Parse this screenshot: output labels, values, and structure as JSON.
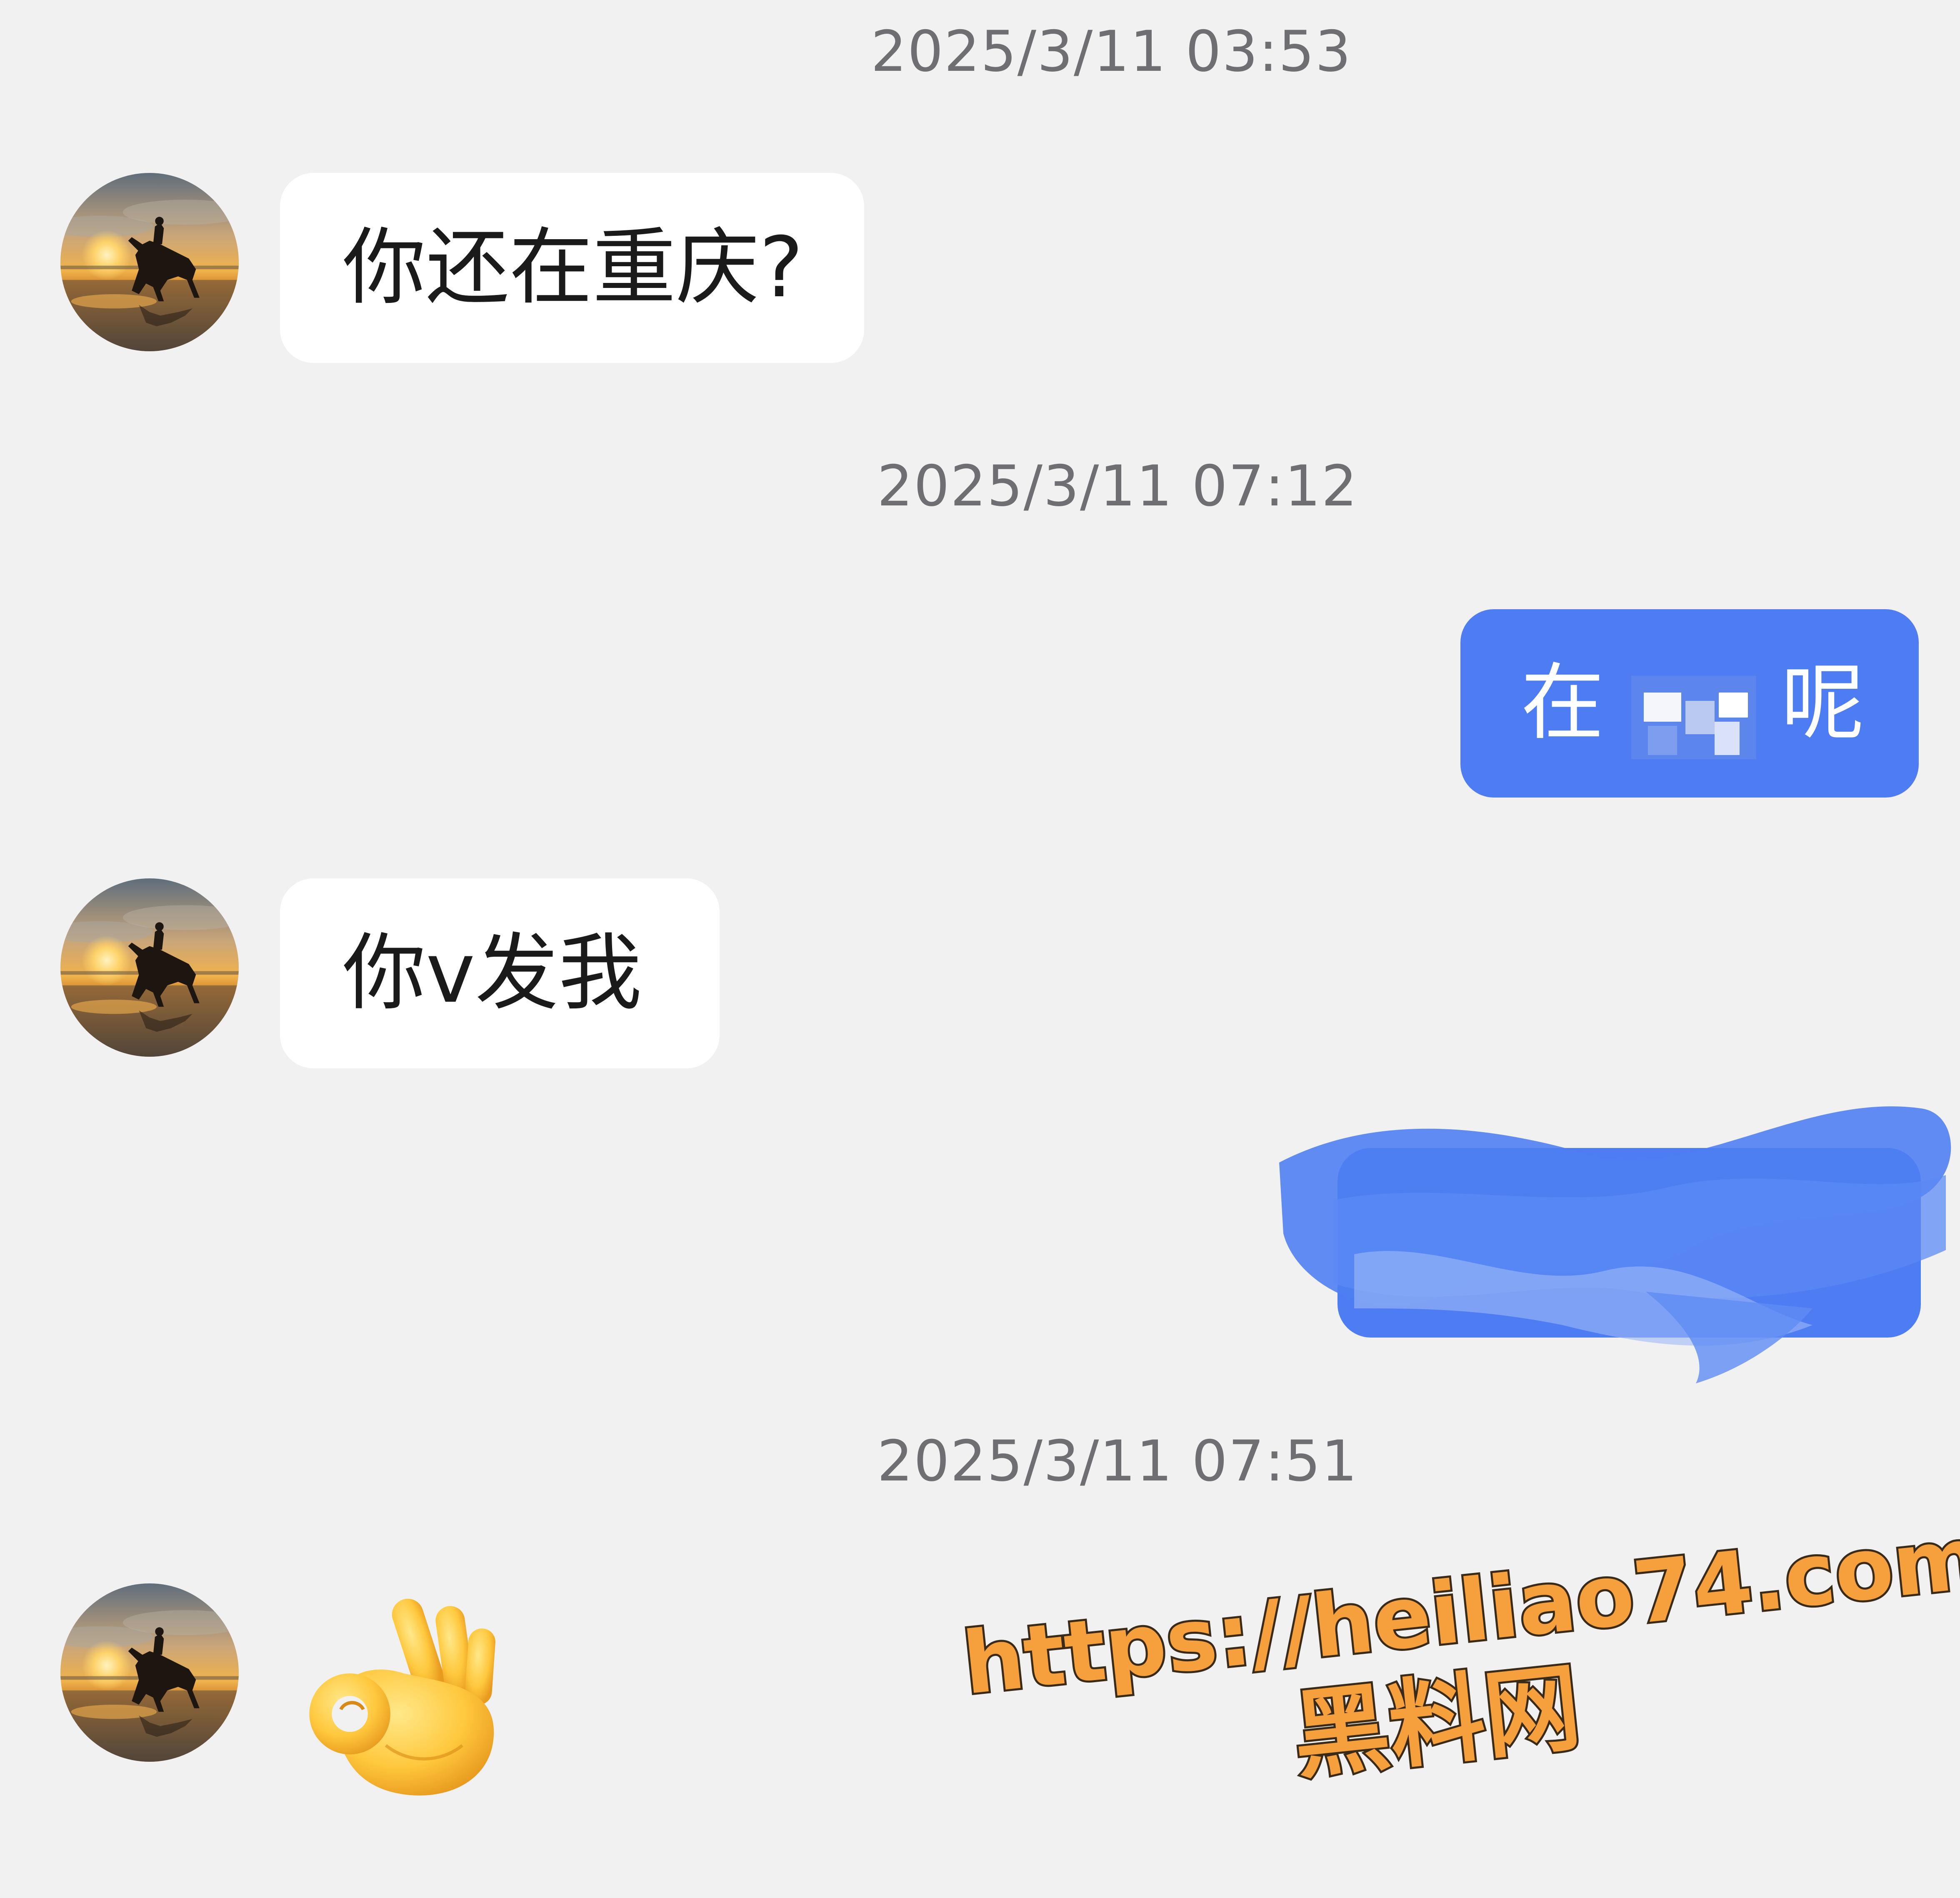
{
  "chat": {
    "timestamps": [
      "2025/3/11 03:53",
      "2025/3/11 07:12",
      "2025/3/11 07:51"
    ],
    "messages": [
      {
        "from": "contact",
        "text": "你还在重庆?"
      },
      {
        "from": "me",
        "text_before": "在",
        "text_after": "呢",
        "redacted": true
      },
      {
        "from": "contact",
        "text": "你v发我"
      },
      {
        "from": "me",
        "text": "",
        "redacted": true
      },
      {
        "from": "contact",
        "emoji": "ok-hand-emoji"
      }
    ]
  },
  "watermark": {
    "url": "https://heiliao74.com",
    "name": "黑料网"
  },
  "colors": {
    "background": "#f1f1f1",
    "outgoing_bubble": "#4e7cf2",
    "incoming_bubble": "#ffffff",
    "timestamp": "#6e6e73",
    "watermark_fill": "#f5a03c",
    "watermark_stroke": "#3a2a18"
  },
  "icons": {
    "avatar": "horse-rider-sunset-avatar",
    "emoji": "ok-hand-emoji"
  }
}
